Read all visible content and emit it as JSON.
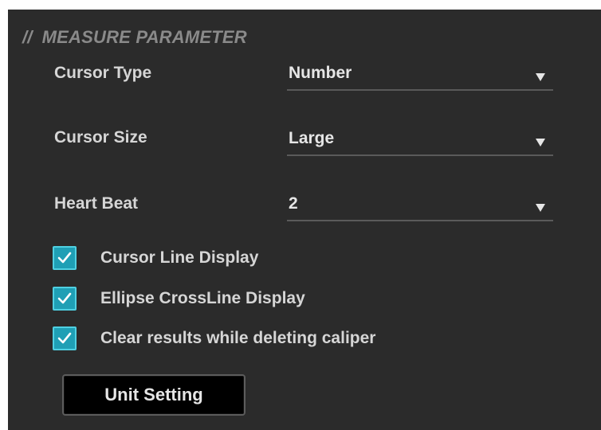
{
  "section": {
    "mark": "//",
    "title": "MEASURE PARAMETER"
  },
  "fields": [
    {
      "label": "Cursor Type",
      "value": "Number"
    },
    {
      "label": "Cursor Size",
      "value": "Large"
    },
    {
      "label": "Heart Beat",
      "value": "2"
    }
  ],
  "checkboxes": [
    {
      "label": "Cursor Line Display",
      "checked": true
    },
    {
      "label": "Ellipse CrossLine Display",
      "checked": true
    },
    {
      "label": "Clear results while deleting caliper",
      "checked": true
    }
  ],
  "button": {
    "label": "Unit Setting"
  },
  "colors": {
    "panel_bg": "#2b2b2b",
    "checkbox_fill": "#1f9fb5",
    "checkbox_border": "#4fd0e2",
    "title_gray": "#8a8a8a",
    "text": "#d6d6d6"
  },
  "icons": {
    "dropdown": "triangle-down-icon",
    "check": "checkmark-icon"
  }
}
